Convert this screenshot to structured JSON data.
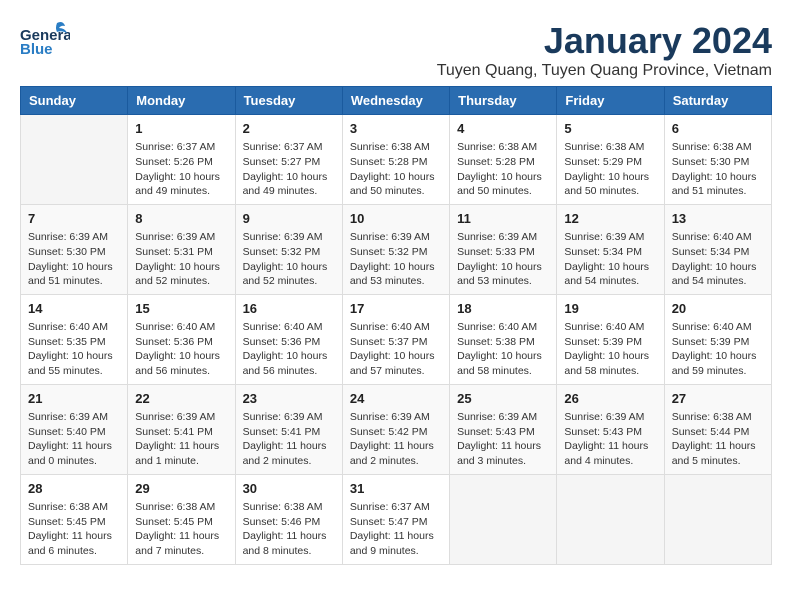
{
  "header": {
    "logo_general": "General",
    "logo_blue": "Blue",
    "month_title": "January 2024",
    "location": "Tuyen Quang, Tuyen Quang Province, Vietnam"
  },
  "days_of_week": [
    "Sunday",
    "Monday",
    "Tuesday",
    "Wednesday",
    "Thursday",
    "Friday",
    "Saturday"
  ],
  "weeks": [
    [
      {
        "day": "",
        "info": ""
      },
      {
        "day": "1",
        "info": "Sunrise: 6:37 AM\nSunset: 5:26 PM\nDaylight: 10 hours\nand 49 minutes."
      },
      {
        "day": "2",
        "info": "Sunrise: 6:37 AM\nSunset: 5:27 PM\nDaylight: 10 hours\nand 49 minutes."
      },
      {
        "day": "3",
        "info": "Sunrise: 6:38 AM\nSunset: 5:28 PM\nDaylight: 10 hours\nand 50 minutes."
      },
      {
        "day": "4",
        "info": "Sunrise: 6:38 AM\nSunset: 5:28 PM\nDaylight: 10 hours\nand 50 minutes."
      },
      {
        "day": "5",
        "info": "Sunrise: 6:38 AM\nSunset: 5:29 PM\nDaylight: 10 hours\nand 50 minutes."
      },
      {
        "day": "6",
        "info": "Sunrise: 6:38 AM\nSunset: 5:30 PM\nDaylight: 10 hours\nand 51 minutes."
      }
    ],
    [
      {
        "day": "7",
        "info": "Sunrise: 6:39 AM\nSunset: 5:30 PM\nDaylight: 10 hours\nand 51 minutes."
      },
      {
        "day": "8",
        "info": "Sunrise: 6:39 AM\nSunset: 5:31 PM\nDaylight: 10 hours\nand 52 minutes."
      },
      {
        "day": "9",
        "info": "Sunrise: 6:39 AM\nSunset: 5:32 PM\nDaylight: 10 hours\nand 52 minutes."
      },
      {
        "day": "10",
        "info": "Sunrise: 6:39 AM\nSunset: 5:32 PM\nDaylight: 10 hours\nand 53 minutes."
      },
      {
        "day": "11",
        "info": "Sunrise: 6:39 AM\nSunset: 5:33 PM\nDaylight: 10 hours\nand 53 minutes."
      },
      {
        "day": "12",
        "info": "Sunrise: 6:39 AM\nSunset: 5:34 PM\nDaylight: 10 hours\nand 54 minutes."
      },
      {
        "day": "13",
        "info": "Sunrise: 6:40 AM\nSunset: 5:34 PM\nDaylight: 10 hours\nand 54 minutes."
      }
    ],
    [
      {
        "day": "14",
        "info": "Sunrise: 6:40 AM\nSunset: 5:35 PM\nDaylight: 10 hours\nand 55 minutes."
      },
      {
        "day": "15",
        "info": "Sunrise: 6:40 AM\nSunset: 5:36 PM\nDaylight: 10 hours\nand 56 minutes."
      },
      {
        "day": "16",
        "info": "Sunrise: 6:40 AM\nSunset: 5:36 PM\nDaylight: 10 hours\nand 56 minutes."
      },
      {
        "day": "17",
        "info": "Sunrise: 6:40 AM\nSunset: 5:37 PM\nDaylight: 10 hours\nand 57 minutes."
      },
      {
        "day": "18",
        "info": "Sunrise: 6:40 AM\nSunset: 5:38 PM\nDaylight: 10 hours\nand 58 minutes."
      },
      {
        "day": "19",
        "info": "Sunrise: 6:40 AM\nSunset: 5:39 PM\nDaylight: 10 hours\nand 58 minutes."
      },
      {
        "day": "20",
        "info": "Sunrise: 6:40 AM\nSunset: 5:39 PM\nDaylight: 10 hours\nand 59 minutes."
      }
    ],
    [
      {
        "day": "21",
        "info": "Sunrise: 6:39 AM\nSunset: 5:40 PM\nDaylight: 11 hours\nand 0 minutes."
      },
      {
        "day": "22",
        "info": "Sunrise: 6:39 AM\nSunset: 5:41 PM\nDaylight: 11 hours\nand 1 minute."
      },
      {
        "day": "23",
        "info": "Sunrise: 6:39 AM\nSunset: 5:41 PM\nDaylight: 11 hours\nand 2 minutes."
      },
      {
        "day": "24",
        "info": "Sunrise: 6:39 AM\nSunset: 5:42 PM\nDaylight: 11 hours\nand 2 minutes."
      },
      {
        "day": "25",
        "info": "Sunrise: 6:39 AM\nSunset: 5:43 PM\nDaylight: 11 hours\nand 3 minutes."
      },
      {
        "day": "26",
        "info": "Sunrise: 6:39 AM\nSunset: 5:43 PM\nDaylight: 11 hours\nand 4 minutes."
      },
      {
        "day": "27",
        "info": "Sunrise: 6:38 AM\nSunset: 5:44 PM\nDaylight: 11 hours\nand 5 minutes."
      }
    ],
    [
      {
        "day": "28",
        "info": "Sunrise: 6:38 AM\nSunset: 5:45 PM\nDaylight: 11 hours\nand 6 minutes."
      },
      {
        "day": "29",
        "info": "Sunrise: 6:38 AM\nSunset: 5:45 PM\nDaylight: 11 hours\nand 7 minutes."
      },
      {
        "day": "30",
        "info": "Sunrise: 6:38 AM\nSunset: 5:46 PM\nDaylight: 11 hours\nand 8 minutes."
      },
      {
        "day": "31",
        "info": "Sunrise: 6:37 AM\nSunset: 5:47 PM\nDaylight: 11 hours\nand 9 minutes."
      },
      {
        "day": "",
        "info": ""
      },
      {
        "day": "",
        "info": ""
      },
      {
        "day": "",
        "info": ""
      }
    ]
  ]
}
